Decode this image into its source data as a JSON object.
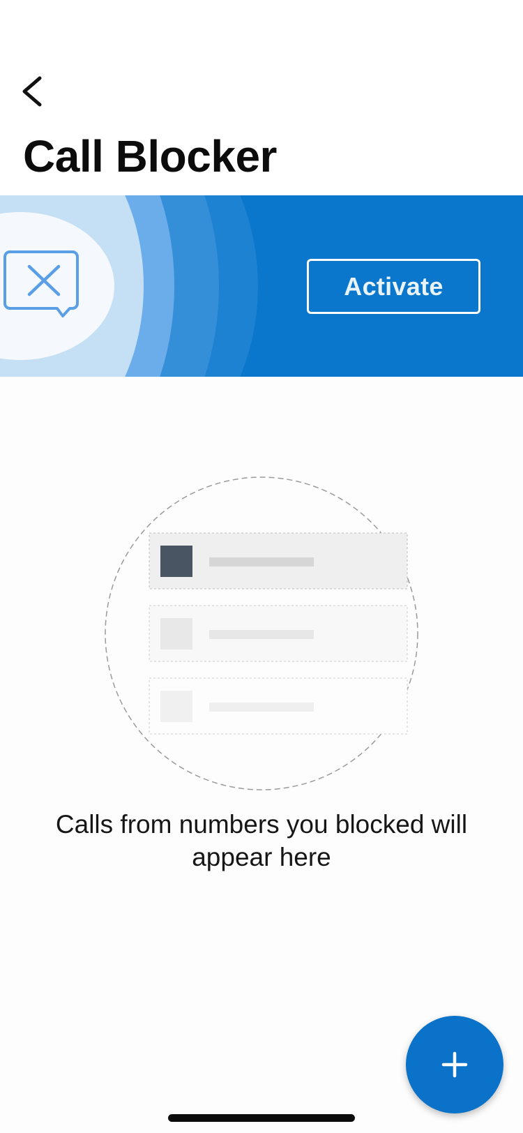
{
  "header": {
    "title": "Call Blocker"
  },
  "banner": {
    "activate_label": "Activate",
    "background_color": "#0a76cc"
  },
  "empty_state": {
    "message": "Calls from numbers you blocked will appear here"
  },
  "icons": {
    "back": "chevron-left-icon",
    "block": "blocked-message-icon",
    "add": "plus-icon"
  },
  "colors": {
    "accent": "#0a73c9",
    "ring_light": "#c5dff5"
  }
}
